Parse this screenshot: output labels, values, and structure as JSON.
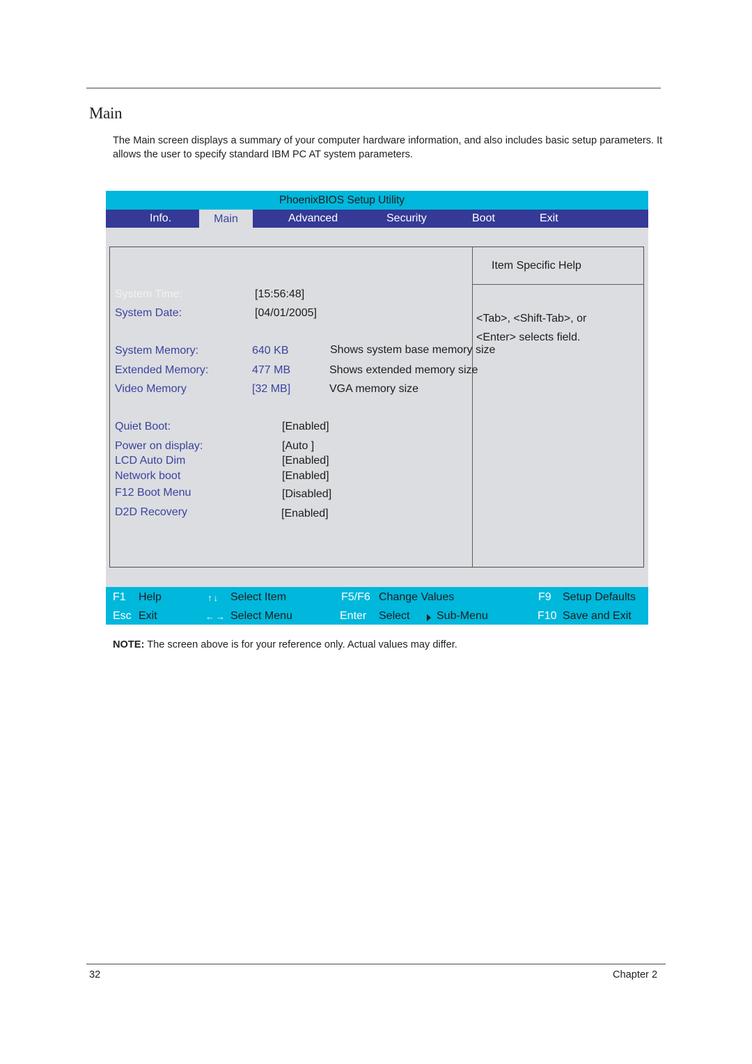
{
  "page": {
    "section_title": "Main",
    "intro": "The Main screen displays a summary of your computer hardware information, and also includes basic setup parameters. It allows the user to specify standard IBM PC AT system parameters.",
    "note_label": "NOTE:",
    "note_text": " The screen above is for your reference only. Actual values may differ.",
    "page_number": "32",
    "chapter": "Chapter 2"
  },
  "bios": {
    "title": "PhoenixBIOS Setup Utility",
    "tabs": [
      {
        "label": "Info.",
        "active": false
      },
      {
        "label": "Main",
        "active": true
      },
      {
        "label": "Advanced",
        "active": false
      },
      {
        "label": "Security",
        "active": false
      },
      {
        "label": "Boot",
        "active": false
      },
      {
        "label": "Exit",
        "active": false
      }
    ],
    "colors": {
      "header": "#00b7dc",
      "tab_bar": "#343a96",
      "body": "#dcdde0",
      "label_blue": "#3a43a0"
    },
    "items": [
      {
        "label": "System Time:",
        "value": "[15:56:48]",
        "selected": true
      },
      {
        "label": "System Date:",
        "value": "[04/01/2005]"
      },
      {
        "label": "System Memory:",
        "value": "640 KB",
        "description": "Shows system base memory size"
      },
      {
        "label": "Extended Memory:",
        "value": "477 MB",
        "description": "Shows extended memory size"
      },
      {
        "label": "Video Memory",
        "value": "[32 MB]",
        "description": "VGA memory size"
      },
      {
        "label": "Quiet Boot:",
        "value": "[Enabled]"
      },
      {
        "label": "Power on display:",
        "value": "[Auto ]"
      },
      {
        "label": "LCD Auto Dim",
        "value": "[Enabled]"
      },
      {
        "label": "Network boot",
        "value": "[Enabled]"
      },
      {
        "label": "F12 Boot Menu",
        "value": "[Disabled]"
      },
      {
        "label": "D2D Recovery",
        "value": "[Enabled]"
      }
    ],
    "help": {
      "title": "Item Specific Help",
      "lines": [
        "<Tab>, <Shift-Tab>, or",
        "<Enter> selects field."
      ]
    },
    "footer": {
      "row1": [
        {
          "key": "F1",
          "action": "Help"
        },
        {
          "key": "↑↓",
          "action": "Select Item"
        },
        {
          "key": "F5/F6",
          "action": "Change Values"
        },
        {
          "key": "F9",
          "action": "Setup Defaults"
        }
      ],
      "row2": [
        {
          "key": "Esc",
          "action": "Exit"
        },
        {
          "key": "←→",
          "action": "Select Menu"
        },
        {
          "key": "Enter",
          "action": "Select"
        },
        {
          "key": "▶",
          "action": "Sub-Menu"
        },
        {
          "key": "F10",
          "action": "Save and Exit"
        }
      ]
    }
  }
}
